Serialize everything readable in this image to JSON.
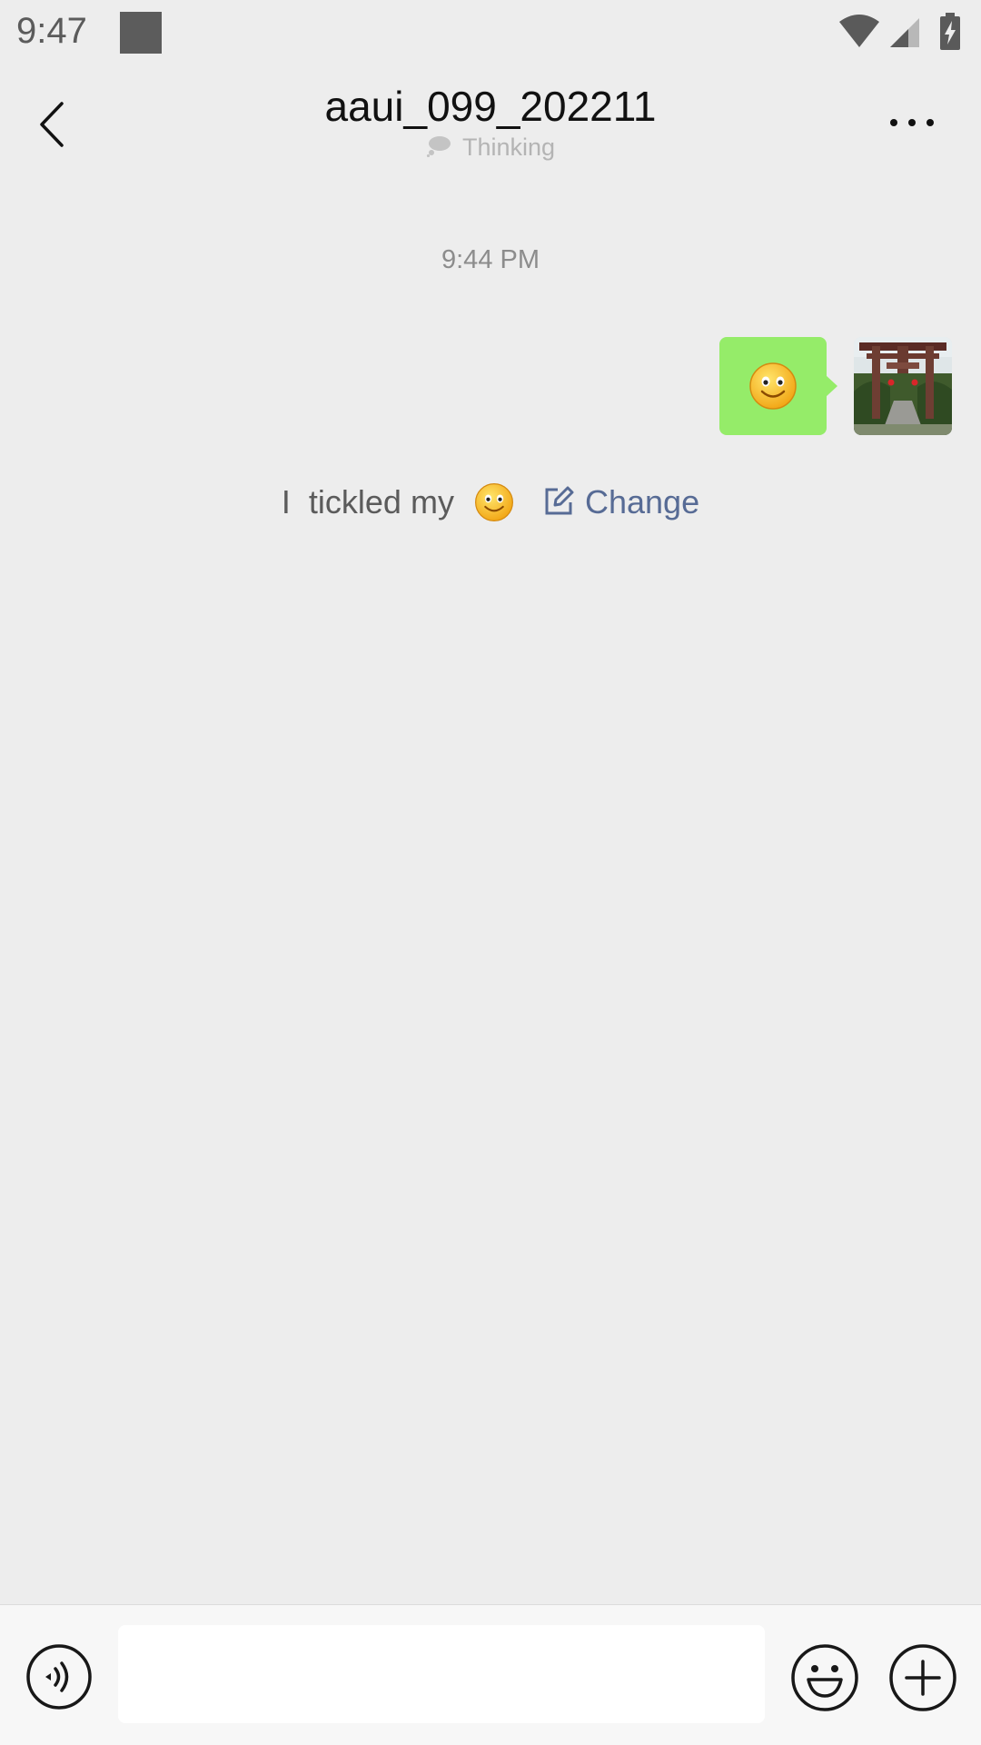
{
  "status_bar": {
    "time": "9:47",
    "icons": [
      "notification-square-icon",
      "wifi-icon",
      "cell-signal-icon",
      "battery-charging-icon"
    ]
  },
  "header": {
    "title": "aaui_099_202211",
    "status_text": "Thinking",
    "back_icon": "chevron-left-icon",
    "more_icon": "more-horizontal-icon"
  },
  "chat": {
    "timestamp": "9:44 PM",
    "messages": [
      {
        "sender": "self",
        "type": "emoji",
        "content": "smiley-emoji",
        "bubble_color": "#95ec69"
      }
    ],
    "system_notice": {
      "text_prefix": "I  tickled my",
      "emoji": "smiley-emoji",
      "link_label": "Change",
      "link_color": "#576b95"
    }
  },
  "bottom_bar": {
    "input_value": "",
    "icons": [
      "voice-icon",
      "emoji-face-icon",
      "plus-icon"
    ]
  },
  "colors": {
    "background": "#ededed",
    "bubble": "#95ec69",
    "link": "#576b95"
  }
}
